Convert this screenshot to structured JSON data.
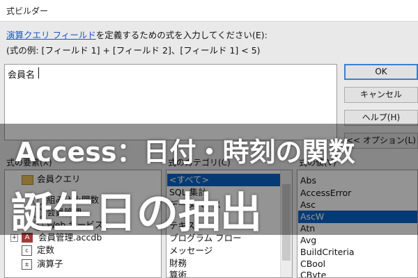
{
  "window": {
    "title": "式ビルダー"
  },
  "description": {
    "link_text": "演算クエリ フィールド",
    "rest_text": "を定義するための式を入力してください(E):",
    "example": "(式の例: [フィールド 1] + [フィールド 2]、[フィールド 1] < 5)"
  },
  "editor": {
    "value": "会員名"
  },
  "buttons": {
    "ok": "OK",
    "cancel": "キャンセル",
    "help": "ヘルプ(H)",
    "options": "<< オプション(L)"
  },
  "labels": {
    "elements": "式の要素(X)",
    "categories": "式のカテゴリ(C)",
    "values": "式の値(V)"
  },
  "elements_tree": {
    "items": [
      {
        "label": "会員クエリ",
        "icon": "query-icon"
      },
      {
        "label": "組み込み関数",
        "icon": "function-icon"
      },
      {
        "label": "会員管理",
        "icon": "function-icon"
      },
      {
        "label": "Web サービス",
        "icon": "function-icon"
      },
      {
        "label": "会員管理.accdb",
        "icon": "database-icon"
      },
      {
        "label": "定数",
        "icon": "constant-icon"
      },
      {
        "label": "演算子",
        "icon": "operator-icon"
      }
    ]
  },
  "categories_list": {
    "items": [
      "<すべて>",
      "SQL 集計",
      "データベース",
      "テキスト",
      "プログラム フロー",
      "メッセージ",
      "財務",
      "算術"
    ],
    "selected_index": 0
  },
  "values_list": {
    "items": [
      "Abs",
      "AccessError",
      "Asc",
      "AscW",
      "Atn",
      "Avg",
      "BuildCriteria",
      "CBool",
      "CByte"
    ],
    "selected_index": 3
  },
  "overlay": {
    "title": "Access：日付・時刻の関数",
    "subtitle": "誕生日の抽出",
    "background": "#000000"
  }
}
